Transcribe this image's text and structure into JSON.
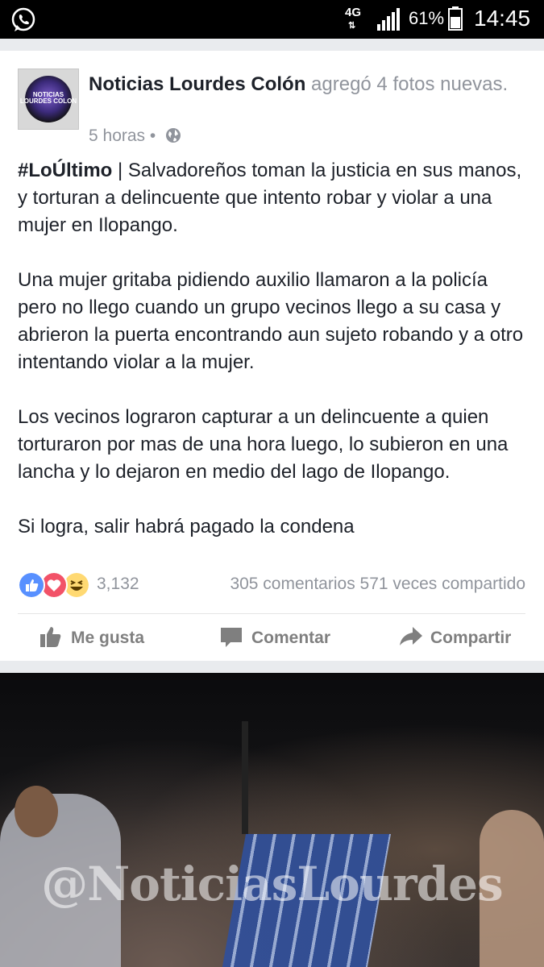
{
  "statusbar": {
    "network": "4G",
    "battery": "61%",
    "time": "14:45"
  },
  "post": {
    "avatar_text": "NOTICIAS LOURDES COLON",
    "page_name": "Noticias Lourdes Colón",
    "action_text": " agregó 4 fotos nuevas.",
    "time": "5 horas",
    "separator": "•",
    "hashtag": "#LoÚltimo",
    "pipe": " | ",
    "p1": "Salvadoreños toman la justicia en sus manos, y torturan a delincuente que intento robar y violar a una mujer en Ilopango.",
    "p2": "Una mujer gritaba pidiendo auxilio llamaron a la policía pero no llego cuando un grupo vecinos llego a su casa y abrieron la puerta encontrando aun sujeto robando y a otro intentando violar a la mujer.",
    "p3": "Los vecinos lograron capturar a un delincuente a quien torturaron por mas de una hora luego, lo subieron en una lancha y lo dejaron en medio del lago de Ilopango.",
    "p4": "Si logra, salir habrá pagado la condena"
  },
  "reactions": {
    "count": "3,132",
    "comments": "305 comentarios",
    "shares": "571 veces compartido",
    "colors": {
      "like": "#5890ff",
      "love": "#f25268",
      "haha": "#ffd972"
    }
  },
  "actions": {
    "like": "Me gusta",
    "comment": "Comentar",
    "share": "Compartir"
  },
  "photo": {
    "watermark": "@NoticiasLourdes"
  }
}
